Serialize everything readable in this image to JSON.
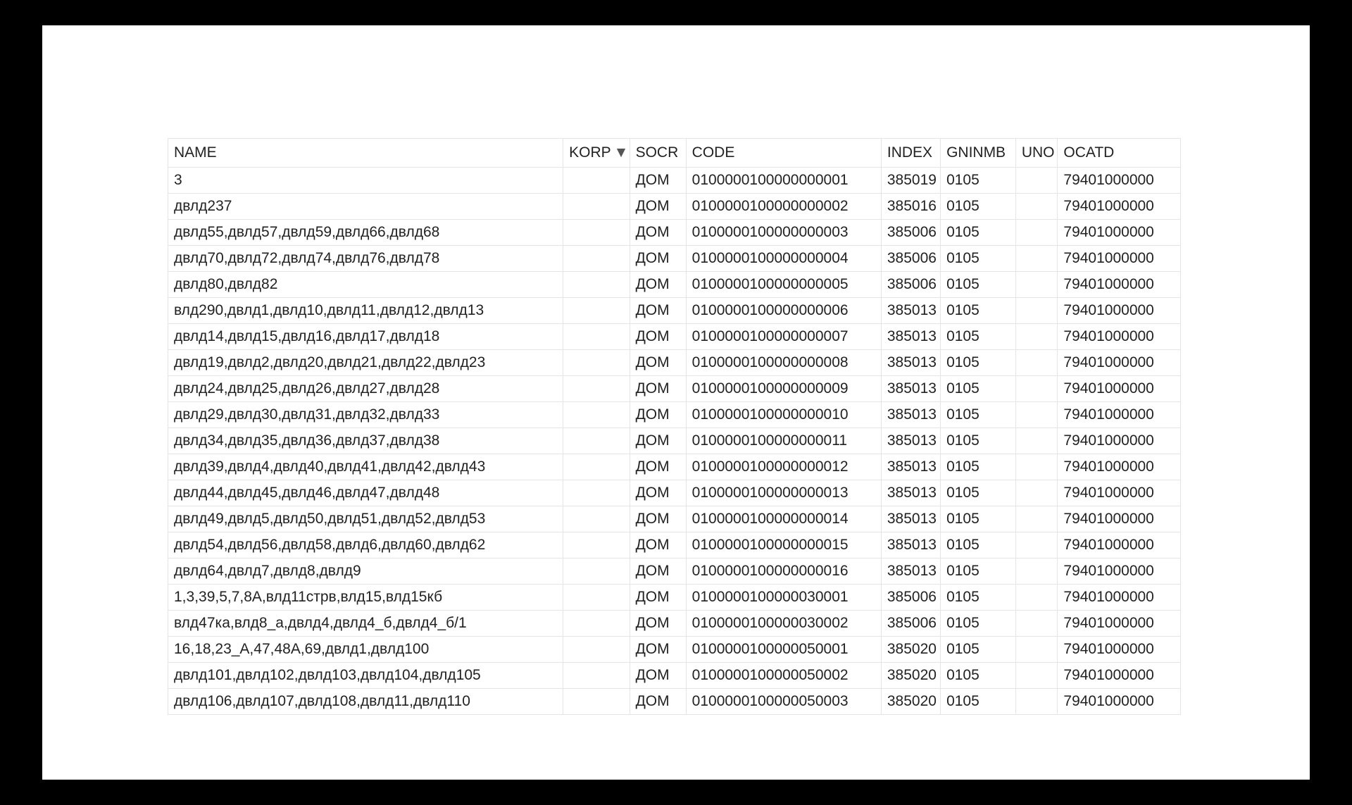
{
  "table": {
    "columns": [
      {
        "key": "name",
        "label": "NAME",
        "sorted": false
      },
      {
        "key": "korp",
        "label": "KORP",
        "sorted": true
      },
      {
        "key": "socr",
        "label": "SOCR",
        "sorted": false
      },
      {
        "key": "code",
        "label": "CODE",
        "sorted": false
      },
      {
        "key": "index",
        "label": "INDEX",
        "sorted": false
      },
      {
        "key": "gninmb",
        "label": "GNINMB",
        "sorted": false
      },
      {
        "key": "uno",
        "label": "UNO",
        "sorted": false
      },
      {
        "key": "ocatd",
        "label": "OCATD",
        "sorted": false
      }
    ],
    "rows": [
      {
        "name": "3",
        "korp": "",
        "socr": "ДОМ",
        "code": "0100000100000000001",
        "index": "385019",
        "gninmb": "0105",
        "uno": "",
        "ocatd": "79401000000"
      },
      {
        "name": "двлд237",
        "korp": "",
        "socr": "ДОМ",
        "code": "0100000100000000002",
        "index": "385016",
        "gninmb": "0105",
        "uno": "",
        "ocatd": "79401000000"
      },
      {
        "name": "двлд55,двлд57,двлд59,двлд66,двлд68",
        "korp": "",
        "socr": "ДОМ",
        "code": "0100000100000000003",
        "index": "385006",
        "gninmb": "0105",
        "uno": "",
        "ocatd": "79401000000"
      },
      {
        "name": "двлд70,двлд72,двлд74,двлд76,двлд78",
        "korp": "",
        "socr": "ДОМ",
        "code": "0100000100000000004",
        "index": "385006",
        "gninmb": "0105",
        "uno": "",
        "ocatd": "79401000000"
      },
      {
        "name": "двлд80,двлд82",
        "korp": "",
        "socr": "ДОМ",
        "code": "0100000100000000005",
        "index": "385006",
        "gninmb": "0105",
        "uno": "",
        "ocatd": "79401000000"
      },
      {
        "name": "влд290,двлд1,двлд10,двлд11,двлд12,двлд13",
        "korp": "",
        "socr": "ДОМ",
        "code": "0100000100000000006",
        "index": "385013",
        "gninmb": "0105",
        "uno": "",
        "ocatd": "79401000000"
      },
      {
        "name": "двлд14,двлд15,двлд16,двлд17,двлд18",
        "korp": "",
        "socr": "ДОМ",
        "code": "0100000100000000007",
        "index": "385013",
        "gninmb": "0105",
        "uno": "",
        "ocatd": "79401000000"
      },
      {
        "name": "двлд19,двлд2,двлд20,двлд21,двлд22,двлд23",
        "korp": "",
        "socr": "ДОМ",
        "code": "0100000100000000008",
        "index": "385013",
        "gninmb": "0105",
        "uno": "",
        "ocatd": "79401000000"
      },
      {
        "name": "двлд24,двлд25,двлд26,двлд27,двлд28",
        "korp": "",
        "socr": "ДОМ",
        "code": "0100000100000000009",
        "index": "385013",
        "gninmb": "0105",
        "uno": "",
        "ocatd": "79401000000"
      },
      {
        "name": "двлд29,двлд30,двлд31,двлд32,двлд33",
        "korp": "",
        "socr": "ДОМ",
        "code": "0100000100000000010",
        "index": "385013",
        "gninmb": "0105",
        "uno": "",
        "ocatd": "79401000000"
      },
      {
        "name": "двлд34,двлд35,двлд36,двлд37,двлд38",
        "korp": "",
        "socr": "ДОМ",
        "code": "0100000100000000011",
        "index": "385013",
        "gninmb": "0105",
        "uno": "",
        "ocatd": "79401000000"
      },
      {
        "name": "двлд39,двлд4,двлд40,двлд41,двлд42,двлд43",
        "korp": "",
        "socr": "ДОМ",
        "code": "0100000100000000012",
        "index": "385013",
        "gninmb": "0105",
        "uno": "",
        "ocatd": "79401000000"
      },
      {
        "name": "двлд44,двлд45,двлд46,двлд47,двлд48",
        "korp": "",
        "socr": "ДОМ",
        "code": "0100000100000000013",
        "index": "385013",
        "gninmb": "0105",
        "uno": "",
        "ocatd": "79401000000"
      },
      {
        "name": "двлд49,двлд5,двлд50,двлд51,двлд52,двлд53",
        "korp": "",
        "socr": "ДОМ",
        "code": "0100000100000000014",
        "index": "385013",
        "gninmb": "0105",
        "uno": "",
        "ocatd": "79401000000"
      },
      {
        "name": "двлд54,двлд56,двлд58,двлд6,двлд60,двлд62",
        "korp": "",
        "socr": "ДОМ",
        "code": "0100000100000000015",
        "index": "385013",
        "gninmb": "0105",
        "uno": "",
        "ocatd": "79401000000"
      },
      {
        "name": "двлд64,двлд7,двлд8,двлд9",
        "korp": "",
        "socr": "ДОМ",
        "code": "0100000100000000016",
        "index": "385013",
        "gninmb": "0105",
        "uno": "",
        "ocatd": "79401000000"
      },
      {
        "name": "1,3,39,5,7,8А,влд11стрв,влд15,влд15кб",
        "korp": "",
        "socr": "ДОМ",
        "code": "0100000100000030001",
        "index": "385006",
        "gninmb": "0105",
        "uno": "",
        "ocatd": "79401000000"
      },
      {
        "name": "влд47ка,влд8_а,двлд4,двлд4_б,двлд4_б/1",
        "korp": "",
        "socr": "ДОМ",
        "code": "0100000100000030002",
        "index": "385006",
        "gninmb": "0105",
        "uno": "",
        "ocatd": "79401000000"
      },
      {
        "name": "16,18,23_А,47,48А,69,двлд1,двлд100",
        "korp": "",
        "socr": "ДОМ",
        "code": "0100000100000050001",
        "index": "385020",
        "gninmb": "0105",
        "uno": "",
        "ocatd": "79401000000"
      },
      {
        "name": "двлд101,двлд102,двлд103,двлд104,двлд105",
        "korp": "",
        "socr": "ДОМ",
        "code": "0100000100000050002",
        "index": "385020",
        "gninmb": "0105",
        "uno": "",
        "ocatd": "79401000000"
      },
      {
        "name": "двлд106,двлд107,двлд108,двлд11,двлд110",
        "korp": "",
        "socr": "ДОМ",
        "code": "0100000100000050003",
        "index": "385020",
        "gninmb": "0105",
        "uno": "",
        "ocatd": "79401000000"
      }
    ]
  }
}
